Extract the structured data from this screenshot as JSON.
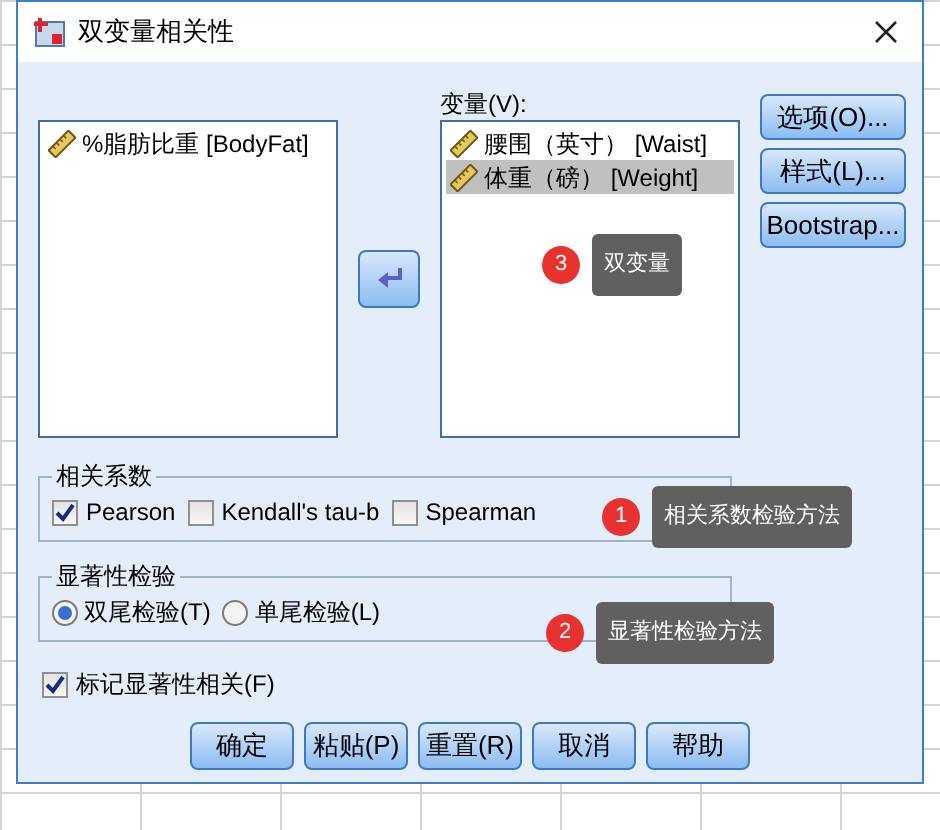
{
  "window": {
    "title": "双变量相关性"
  },
  "source_list": {
    "items": [
      {
        "label": "%脂肪比重 [BodyFat]",
        "selected": false
      }
    ]
  },
  "variables": {
    "label": "变量(V):",
    "items": [
      {
        "label": "腰围（英寸） [Waist]",
        "selected": false
      },
      {
        "label": "体重（磅） [Weight]",
        "selected": true
      }
    ]
  },
  "side_buttons": [
    "选项(O)...",
    "样式(L)...",
    "Bootstrap..."
  ],
  "coefficients": {
    "title": "相关系数",
    "options": [
      {
        "label": "Pearson",
        "checked": true
      },
      {
        "label": "Kendall's tau-b",
        "checked": false
      },
      {
        "label": "Spearman",
        "checked": false
      }
    ]
  },
  "significance": {
    "title": "显著性检验",
    "options": [
      {
        "label": "双尾检验(T)",
        "selected": true
      },
      {
        "label": "单尾检验(L)",
        "selected": false
      }
    ]
  },
  "flag": {
    "label": "标记显著性相关(F)",
    "checked": true
  },
  "buttons": [
    "确定",
    "粘贴(P)",
    "重置(R)",
    "取消",
    "帮助"
  ],
  "annotations": [
    {
      "number": "3",
      "text": "双变量"
    },
    {
      "number": "1",
      "text": "相关系数检验方法"
    },
    {
      "number": "2",
      "text": "显著性检验方法"
    }
  ]
}
